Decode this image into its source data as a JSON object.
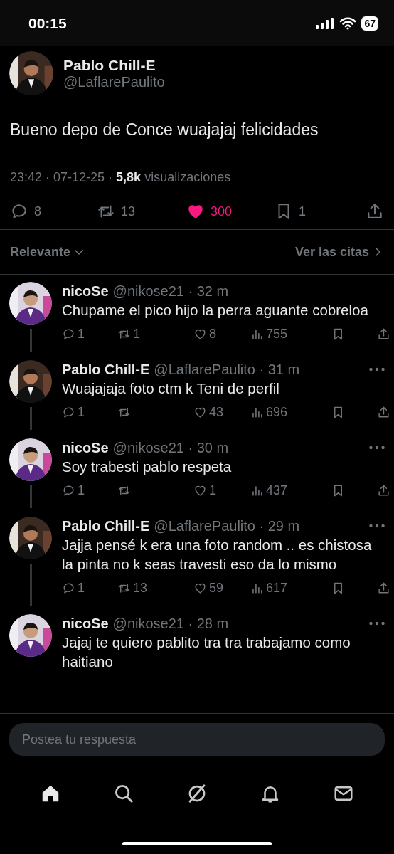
{
  "status_bar": {
    "time": "00:15",
    "battery": "67"
  },
  "post": {
    "name": "Pablo Chill-E",
    "handle": "@LaflarePaulito",
    "text": "Bueno depo de Conce wuajajaj felicidades",
    "timestamp": "23:42 · 07-12-25 ·",
    "views": "5,8k",
    "views_label": "visualizaciones",
    "replies": "8",
    "reposts": "13",
    "likes": "300",
    "liked": true,
    "bookmarks": "1",
    "bookmarked": false
  },
  "sort": {
    "label": "Relevante",
    "quotes_link": "Ver las citas"
  },
  "replies": [
    {
      "name_text": "nicoSe",
      "handle": "@nikose21",
      "time": "· 32 m",
      "text": "Chupame el pico hijo la perra aguante cobreloa",
      "replies": "1",
      "reposts": "1",
      "likes": "8",
      "views": "755",
      "more_menu": false,
      "connected": true
    },
    {
      "name_text": "Pablo Chill-E",
      "handle": "@LaflarePaulito",
      "time": "· 31 m",
      "text": "Wuajajaja foto ctm k Teni de perfil",
      "replies": "1",
      "likes": "43",
      "views": "696",
      "more_menu": true,
      "connected": true
    },
    {
      "name_text": "nicoSe",
      "handle": "@nikose21",
      "time": "· 30 m",
      "text": "Soy trabesti pablo respeta",
      "replies": "1",
      "likes": "1",
      "views": "437",
      "more_menu": true,
      "connected": true
    },
    {
      "name_text": "Pablo Chill-E",
      "handle": "@LaflarePaulito",
      "time": "· 29 m",
      "text": "Jajja pensé k era una foto random .. es chistosa la pinta no k seas travesti eso da lo mismo",
      "replies": "1",
      "reposts": "13",
      "likes": "59",
      "views": "617",
      "more_menu": true,
      "connected": true
    },
    {
      "name_text": "nicoSe",
      "handle": "@nikose21",
      "time": "· 28 m",
      "text": "Jajaj te quiero pablito tra tra trabajamo como haitiano",
      "more_menu": true,
      "connected": false
    }
  ],
  "composer": {
    "placeholder": "Postea tu respuesta"
  },
  "tab_bar": [
    {
      "kind": "home",
      "selected": true
    },
    {
      "kind": "search",
      "selected": false
    },
    {
      "kind": "grok",
      "selected": false
    },
    {
      "kind": "notifications",
      "selected": false
    },
    {
      "kind": "messages",
      "selected": false
    }
  ]
}
